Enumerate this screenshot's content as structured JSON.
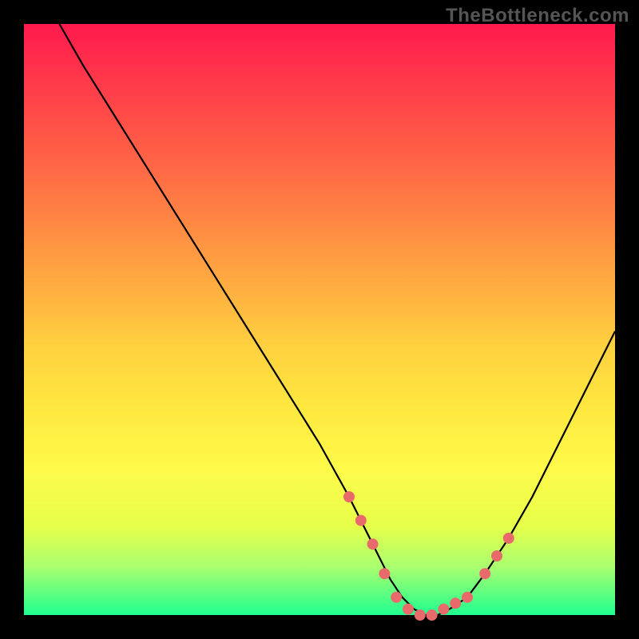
{
  "watermark": "TheBottleneck.com",
  "chart_data": {
    "type": "line",
    "title": "",
    "xlabel": "",
    "ylabel": "",
    "xlim": [
      0,
      100
    ],
    "ylim": [
      0,
      100
    ],
    "grid": false,
    "legend": false,
    "series": [
      {
        "name": "bottleneck-curve",
        "stroke": "#000000",
        "x": [
          6,
          10,
          15,
          20,
          25,
          30,
          35,
          40,
          45,
          50,
          55,
          58,
          60,
          62,
          64,
          66,
          68,
          70,
          72,
          75,
          78,
          82,
          86,
          90,
          94,
          98,
          100
        ],
        "y": [
          100,
          93,
          85,
          77,
          69,
          61,
          53,
          45,
          37,
          29,
          20,
          14,
          10,
          6,
          3,
          1,
          0,
          0,
          1,
          3,
          7,
          13,
          20,
          28,
          36,
          44,
          48
        ]
      }
    ],
    "markers": {
      "name": "highlight-dots",
      "fill": "#e86a6a",
      "radius": 7,
      "x": [
        55,
        57,
        59,
        61,
        63,
        65,
        67,
        69,
        71,
        73,
        75,
        78,
        80,
        82
      ],
      "y": [
        20,
        16,
        12,
        7,
        3,
        1,
        0,
        0,
        1,
        2,
        3,
        7,
        10,
        13
      ]
    }
  }
}
